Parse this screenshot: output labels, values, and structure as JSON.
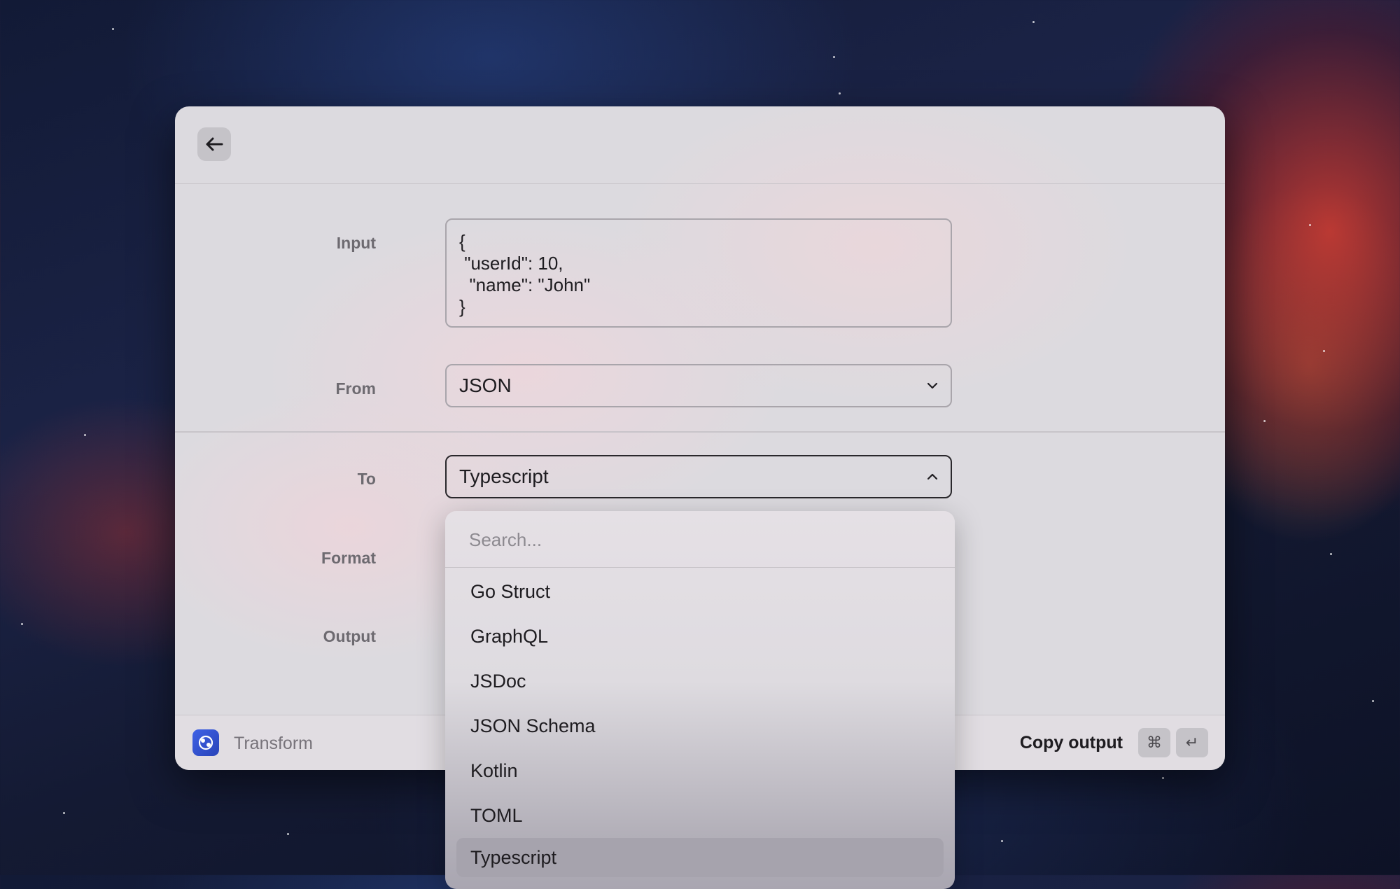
{
  "form": {
    "input_label": "Input",
    "input_value": "{\n \"userId\": 10,\n  \"name\": \"John\"\n}",
    "from_label": "From",
    "from_value": "JSON",
    "to_label": "To",
    "to_value": "Typescript",
    "format_label": "Format",
    "output_label": "Output"
  },
  "dropdown": {
    "search_placeholder": "Search...",
    "options": [
      "Go Struct",
      "GraphQL",
      "JSDoc",
      "JSON Schema",
      "Kotlin",
      "TOML",
      "Typescript"
    ],
    "selected": "Typescript"
  },
  "footer": {
    "app_name": "Transform",
    "action_label": "Copy output",
    "shortcut_keys": [
      "⌘",
      "↵"
    ]
  },
  "icons": {
    "back": "arrow-left-icon",
    "from_chevron": "chevron-down-icon",
    "to_chevron": "chevron-up-icon",
    "app": "transform-app-icon"
  },
  "colors": {
    "app_icon": "#3556d6",
    "selected_option": "#a6a3ad"
  }
}
